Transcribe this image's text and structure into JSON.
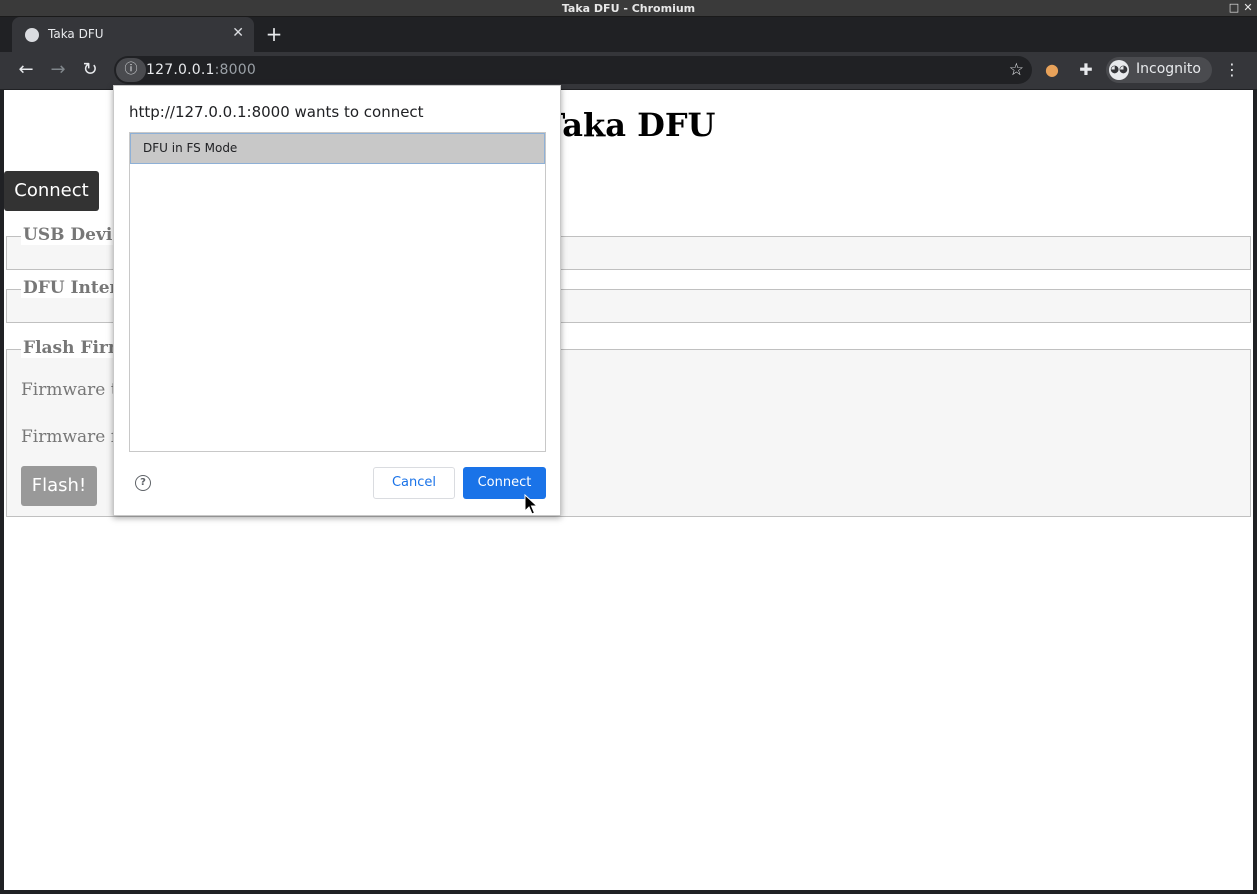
{
  "window": {
    "title": "Taka DFU - Chromium"
  },
  "tab": {
    "title": "Taka DFU"
  },
  "address": {
    "host": "127.0.0.1",
    "port": ":8000"
  },
  "profile": {
    "label": "Incognito"
  },
  "page": {
    "heading": "Taka DFU",
    "connect_label": "Connect",
    "sections": {
      "usb": "USB Device",
      "dfu": "DFU Interf",
      "flash": "Flash Firm"
    },
    "firmware_type_label": "Firmware ty",
    "firmware_file_label": "Firmware fil",
    "flash_label": "Flash!"
  },
  "dialog": {
    "title": "http://127.0.0.1:8000 wants to connect",
    "devices": [
      "DFU in FS Mode"
    ],
    "cancel_label": "Cancel",
    "connect_label": "Connect",
    "help_glyph": "?"
  },
  "colors": {
    "accent": "#1a73e8",
    "selected_row": "#c8c8c8"
  }
}
